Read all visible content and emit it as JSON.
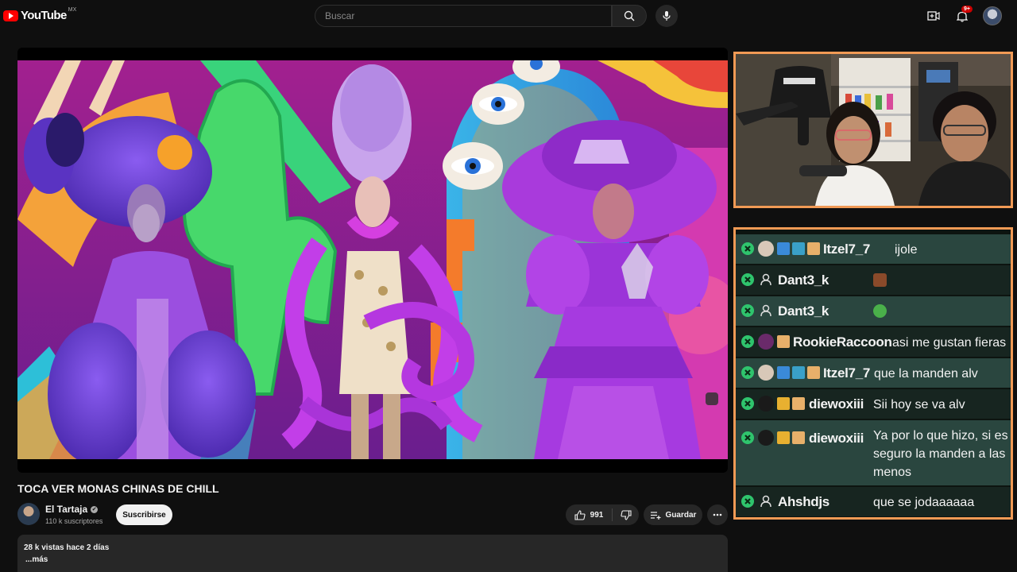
{
  "header": {
    "logo_text": "YouTube",
    "country_code": "MX",
    "search_placeholder": "Buscar",
    "notification_count": "9+"
  },
  "video": {
    "title": "TOCA VER MONAS CHINAS DE CHILL"
  },
  "channel": {
    "name": "El Tartaja",
    "verified_mark": "✔",
    "subscribers": "110 k suscriptores",
    "subscribe_label": "Suscribirse"
  },
  "actions": {
    "like_count": "991",
    "save_label": "Guardar"
  },
  "description": {
    "stats": "28 k vistas  hace 2 días",
    "more_label": "...más"
  },
  "chat": {
    "messages": [
      {
        "user": "Itzel7_7",
        "text": "ijole"
      },
      {
        "user": "Dant3_k",
        "text": ""
      },
      {
        "user": "Dant3_k",
        "text": ""
      },
      {
        "user": "RookieRaccoon",
        "text": "asi me gustan fieras"
      },
      {
        "user": "Itzel7_7",
        "text": "que la manden alv"
      },
      {
        "user": "diewoxiii",
        "text": "Sii hoy se va alv"
      },
      {
        "user": "diewoxiii",
        "text": "Ya por lo que hizo, si es seguro la manden a las menos"
      },
      {
        "user": "Ahshdjs",
        "text": "que se jodaaaaaa"
      }
    ]
  },
  "colors": {
    "accent_border": "#f19a55",
    "mod_green": "#2fc46d",
    "chat_row_light": "#2a463f",
    "chat_row_dark": "#172520",
    "youtube_red": "#ff0000"
  },
  "icons": [
    "youtube-logo-icon",
    "search-icon",
    "mic-icon",
    "create-icon",
    "bell-icon",
    "like-icon",
    "dislike-icon",
    "save-playlist-icon",
    "more-icon",
    "moderator-icon",
    "user-icon",
    "emote-icon"
  ]
}
